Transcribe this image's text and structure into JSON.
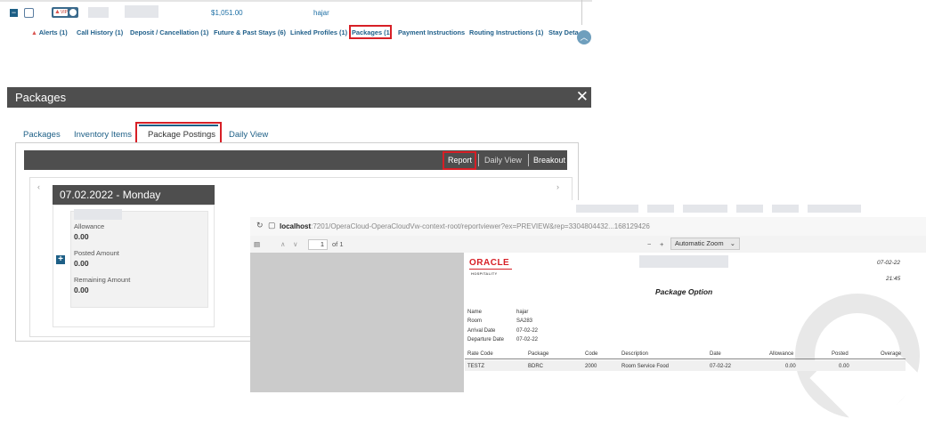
{
  "reservation_row": {
    "vip_label": "VIP",
    "amount": "$1,051.00",
    "guest": "hajar",
    "tabs": [
      {
        "label": "Alerts (1)",
        "warn": true
      },
      {
        "label": "Call History (1)"
      },
      {
        "label": "Deposit / Cancellation (1)"
      },
      {
        "label": "Future & Past Stays (6)"
      },
      {
        "label": "Linked Profiles (1)"
      },
      {
        "label": "Packages (1)",
        "highlighted": true
      },
      {
        "label": "Payment Instructions"
      },
      {
        "label": "Routing Instructions (1)"
      },
      {
        "label": "Stay Deta"
      }
    ]
  },
  "dialog": {
    "title": "Packages",
    "close": "✕",
    "tabs": [
      "Packages",
      "Inventory Items",
      "Package Postings",
      "Daily View"
    ],
    "active_tab": "Package Postings",
    "toolbar": {
      "report": "Report",
      "daily_view": "Daily View",
      "breakout": "Breakout"
    },
    "nav_prev": "‹",
    "nav_next": "›",
    "date_header": "07.02.2022 - Monday",
    "card": {
      "allowance_label": "Allowance",
      "allowance_value": "0.00",
      "posted_label": "Posted Amount",
      "posted_value": "0.00",
      "remaining_label": "Remaining Amount",
      "remaining_value": "0.00"
    }
  },
  "viewer": {
    "url_host": "localhost",
    "url_rest": ":7201/OperaCloud-OperaCloudVw-context-root/reportviewer?ex=PREVIEW&rep=3304804432...168129426",
    "page_num": "1",
    "page_of": "of 1",
    "zoom": "Automatic Zoom",
    "report": {
      "logo": "ORACLE",
      "logo_sub": "HOSPITALITY",
      "date": "07-02-22",
      "time": "21:45",
      "title": "Package Option",
      "fields": [
        {
          "label": "Name",
          "value": "hajar"
        },
        {
          "label": "Room",
          "value": "SA283"
        },
        {
          "label": "Arrival Date",
          "value": "07-02-22"
        },
        {
          "label": "Departure Date",
          "value": "07-02-22"
        }
      ],
      "columns": [
        "Rate Code",
        "Package",
        "Code",
        "Description",
        "Date",
        "Allowance",
        "Posted",
        "Overage"
      ],
      "rows": [
        [
          "TESTZ",
          "BDRC",
          "2000",
          "Room Service Food",
          "07-02-22",
          "0.00",
          "0.00",
          ""
        ]
      ]
    }
  },
  "colors": {
    "accent": "#1d5f86",
    "highlight": "#d71f26",
    "header": "#4e4e4e"
  }
}
